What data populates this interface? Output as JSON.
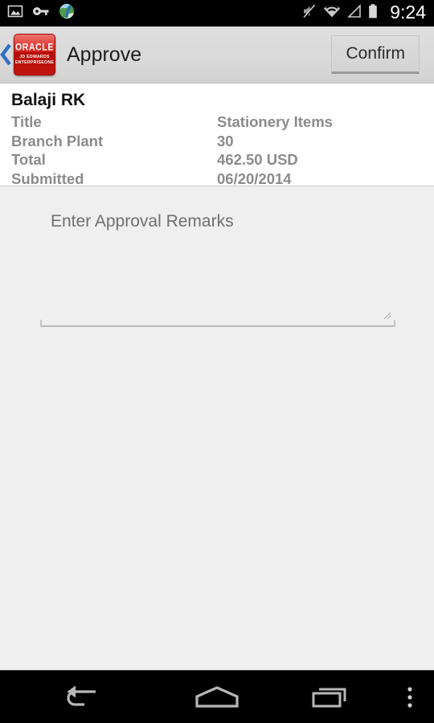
{
  "statusbar": {
    "time": "9:24",
    "left_icons": [
      {
        "name": "screenshot-image-icon",
        "label": "screenshot"
      },
      {
        "name": "vpn-key-icon",
        "label": "vpn"
      },
      {
        "name": "browser-globe-icon",
        "label": "browser"
      }
    ],
    "right_icons": [
      {
        "name": "volume-mute-icon",
        "label": "silent"
      },
      {
        "name": "wifi-icon",
        "label": "wifi"
      },
      {
        "name": "cellular-signal-icon",
        "label": "no-signal"
      },
      {
        "name": "battery-icon",
        "label": "battery"
      }
    ]
  },
  "appbar": {
    "back_label": "‹",
    "logo": {
      "brand": "ORACLE",
      "line2": "JD EDWARDS",
      "line3": "ENTERPRISEONE"
    },
    "title": "Approve",
    "confirm_label": "Confirm"
  },
  "details": {
    "requester": "Balaji RK",
    "rows": [
      {
        "label": "Title",
        "value": "Stationery Items"
      },
      {
        "label": "Branch Plant",
        "value": "30"
      },
      {
        "label": "Total",
        "value": "462.50 USD"
      },
      {
        "label": "Submitted",
        "value": "06/20/2014"
      }
    ]
  },
  "remarks": {
    "placeholder": "Enter Approval Remarks",
    "value": ""
  },
  "navbar": {
    "back_label": "Back",
    "home_label": "Home",
    "recents_label": "Recent apps",
    "menu_label": "Menu"
  },
  "colors": {
    "status_bar": "#000000",
    "app_bar": "#d9d9d9",
    "body": "#efefef",
    "card": "#ffffff",
    "accent_blue": "#2f6fc4",
    "oracle_red": "#d81f16",
    "label_gray": "#8b8b8b"
  }
}
